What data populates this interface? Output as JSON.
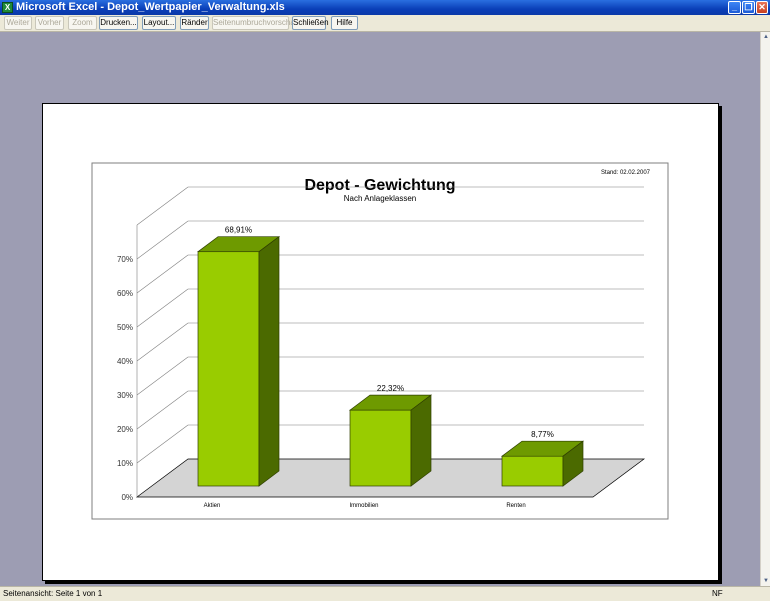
{
  "window": {
    "title": "Microsoft Excel - Depot_Wertpapier_Verwaltung.xls",
    "app_icon": "excel-icon",
    "controls": [
      "minimize-icon",
      "restore-icon",
      "close-icon"
    ]
  },
  "toolbar": {
    "buttons": [
      {
        "label": "Weiter",
        "enabled": false
      },
      {
        "label": "Vorher",
        "enabled": false
      },
      {
        "label": "Zoom",
        "enabled": false
      },
      {
        "label": "Drucken...",
        "enabled": true
      },
      {
        "label": "Layout...",
        "enabled": true
      },
      {
        "label": "Ränder",
        "enabled": true
      },
      {
        "label": "Seitenumbruchvorschau",
        "enabled": false
      },
      {
        "label": "Schließen",
        "enabled": true
      },
      {
        "label": "Hilfe",
        "enabled": true
      }
    ]
  },
  "status": {
    "left": "Seitenansicht: Seite 1 von 1",
    "right": "NF"
  },
  "chart_data": {
    "type": "bar",
    "title": "Depot - Gewichtung",
    "subtitle": "Nach Anlageklassen",
    "stand": "Stand: 02.02.2007",
    "categories": [
      "Aktien",
      "Immobilien",
      "Renten"
    ],
    "values": [
      68.91,
      22.32,
      8.77
    ],
    "data_labels": [
      "68,91%",
      "22,32%",
      "8,77%"
    ],
    "y_ticks": [
      "0%",
      "10%",
      "20%",
      "30%",
      "40%",
      "50%",
      "60%",
      "70%"
    ],
    "ylim": [
      0,
      80
    ],
    "grid": true,
    "colors": {
      "front": "#99cc00",
      "top": "#6e9a00",
      "side": "#4b6a00",
      "floor": "#d4d4d4"
    }
  }
}
